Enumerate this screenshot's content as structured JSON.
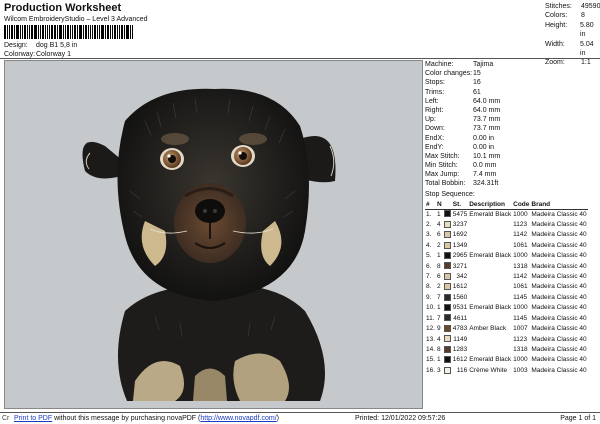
{
  "header": {
    "title": "Production Worksheet",
    "subtitle": "Wilcom EmbroideryStudio – Level 3 Advanced",
    "design_label": "Design:",
    "design_value": "dog B1 5,8 in",
    "colorway_label": "Colorway:",
    "colorway_value": "Colorway 1"
  },
  "summary": [
    {
      "label": "Stitches:",
      "value": "49590"
    },
    {
      "label": "Colors:",
      "value": "8"
    },
    {
      "label": "Height:",
      "value": "5.80 in"
    },
    {
      "label": "Width:",
      "value": "5.04 in"
    },
    {
      "label": "Zoom:",
      "value": "1:1"
    }
  ],
  "specs": [
    {
      "label": "Machine:",
      "value": "Tajima"
    },
    {
      "label": "Color changes:",
      "value": "15"
    },
    {
      "label": "Stops:",
      "value": "16"
    },
    {
      "label": "Trims:",
      "value": "61"
    },
    {
      "label": "Left:",
      "value": "64.0 mm"
    },
    {
      "label": "Right:",
      "value": "64.0 mm"
    },
    {
      "label": "Up:",
      "value": "73.7 mm"
    },
    {
      "label": "Down:",
      "value": "73.7 mm"
    },
    {
      "label": "EndX:",
      "value": "0.00 in"
    },
    {
      "label": "EndY:",
      "value": "0.00 in"
    },
    {
      "label": "Max Stitch:",
      "value": "10.1 mm"
    },
    {
      "label": "Min Stitch:",
      "value": "0.0 mm"
    },
    {
      "label": "Max Jump:",
      "value": "7.4 mm"
    },
    {
      "label": "Total Bobbin:",
      "value": "324.31ft"
    }
  ],
  "sequence": {
    "heading": "Stop Sequence:",
    "columns": [
      "#",
      "N",
      "",
      "St.",
      "Description",
      "Code",
      "Brand"
    ],
    "rows": [
      {
        "n": "1.",
        "needle": "1",
        "color": "#111111",
        "st": "5475",
        "desc": "Emerald Black",
        "code": "1000",
        "brand": "Madeira Classic 40"
      },
      {
        "n": "2.",
        "needle": "4",
        "color": "#e9dcc0",
        "st": "3237",
        "desc": "",
        "code": "1123",
        "brand": "Madeira Classic 40"
      },
      {
        "n": "3.",
        "needle": "6",
        "color": "#d8c9a6",
        "st": "1692",
        "desc": "",
        "code": "1142",
        "brand": "Madeira Classic 40"
      },
      {
        "n": "4.",
        "needle": "2",
        "color": "#d9c8a2",
        "st": "1349",
        "desc": "",
        "code": "1061",
        "brand": "Madeira Classic 40"
      },
      {
        "n": "5.",
        "needle": "1",
        "color": "#111111",
        "st": "2965",
        "desc": "Emerald Black",
        "code": "1000",
        "brand": "Madeira Classic 40"
      },
      {
        "n": "6.",
        "needle": "8",
        "color": "#5a3a2c",
        "st": "3271",
        "desc": "",
        "code": "1318",
        "brand": "Madeira Classic 40"
      },
      {
        "n": "7.",
        "needle": "6",
        "color": "#d8c9a6",
        "st": "342",
        "desc": "",
        "code": "1142",
        "brand": "Madeira Classic 40"
      },
      {
        "n": "8.",
        "needle": "2",
        "color": "#d9c8a2",
        "st": "1612",
        "desc": "",
        "code": "1061",
        "brand": "Madeira Classic 40"
      },
      {
        "n": "9.",
        "needle": "7",
        "color": "#2a2a2a",
        "st": "1560",
        "desc": "",
        "code": "1145",
        "brand": "Madeira Classic 40"
      },
      {
        "n": "10.",
        "needle": "1",
        "color": "#111111",
        "st": "9531",
        "desc": "Emerald Black",
        "code": "1000",
        "brand": "Madeira Classic 40"
      },
      {
        "n": "11.",
        "needle": "7",
        "color": "#2a2a2a",
        "st": "4611",
        "desc": "",
        "code": "1145",
        "brand": "Madeira Classic 40"
      },
      {
        "n": "12.",
        "needle": "9",
        "color": "#6b4a2a",
        "st": "4783",
        "desc": "Amber Black",
        "code": "1007",
        "brand": "Madeira Classic 40"
      },
      {
        "n": "13.",
        "needle": "4",
        "color": "#e9dcc0",
        "st": "1149",
        "desc": "",
        "code": "1123",
        "brand": "Madeira Classic 40"
      },
      {
        "n": "14.",
        "needle": "8",
        "color": "#5a3a2c",
        "st": "1283",
        "desc": "",
        "code": "1318",
        "brand": "Madeira Classic 40"
      },
      {
        "n": "15.",
        "needle": "1",
        "color": "#111111",
        "st": "1612",
        "desc": "Emerald Black",
        "code": "1000",
        "brand": "Madeira Classic 40"
      },
      {
        "n": "16.",
        "needle": "3",
        "color": "#f3efe4",
        "st": "116",
        "desc": "Crème White",
        "code": "1003",
        "brand": "Madeira Classic 40"
      }
    ]
  },
  "footer": {
    "cr": "Cr",
    "link1": "Print to PDF",
    "text": " without this message by purchasing novaPDF (",
    "link2": "http://www.novapdf.com/",
    "text_end": ")",
    "printed": "Printed: 12/01/2022 09:57:26",
    "page": "Page 1 of 1"
  },
  "colors": {
    "canvas_bg": "#c6c9cb",
    "link": "#1a3cc2"
  }
}
